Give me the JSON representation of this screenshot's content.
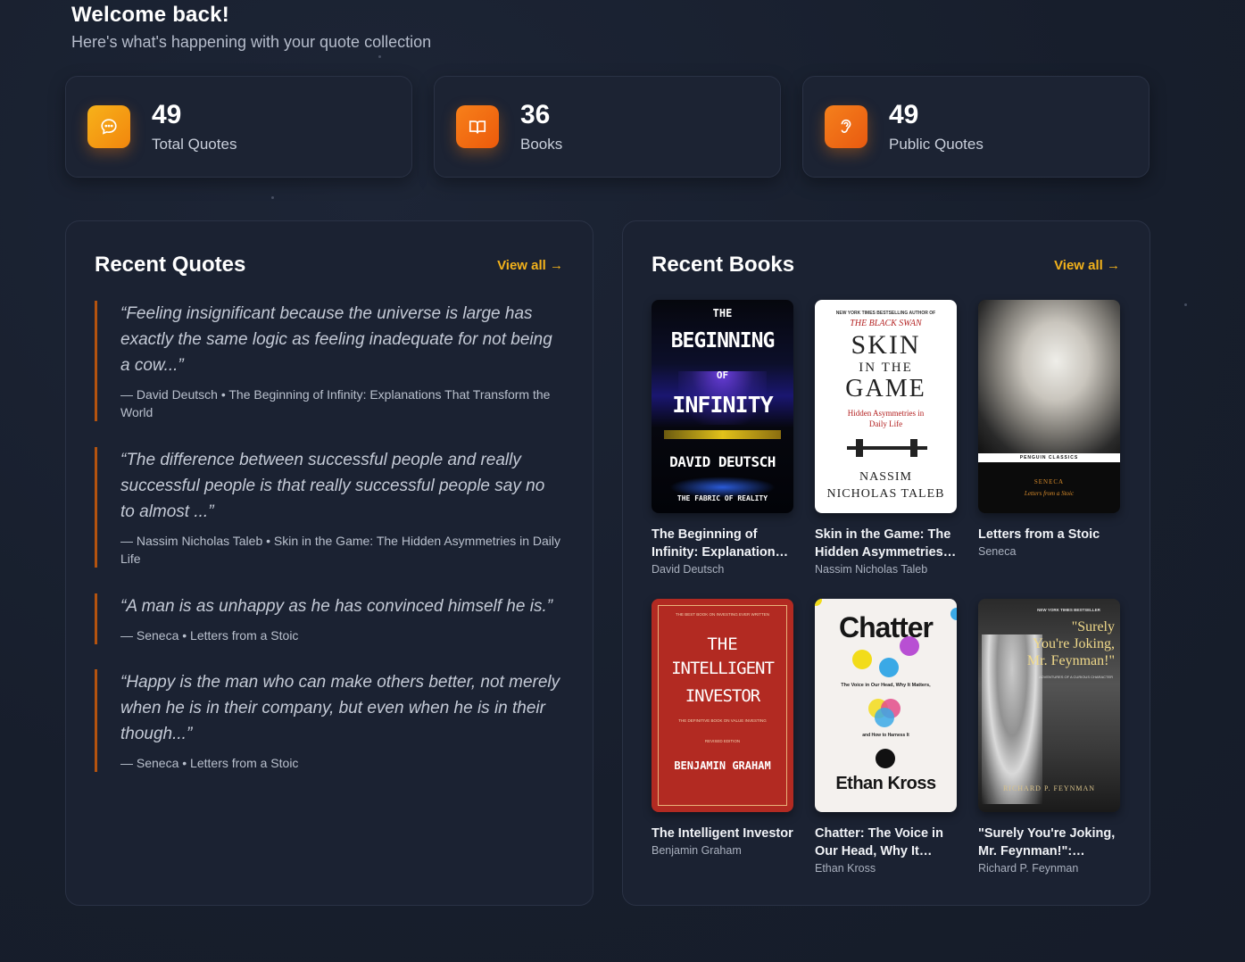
{
  "header": {
    "title": "Welcome back!",
    "subtitle": "Here's what's happening with your quote collection"
  },
  "stats": [
    {
      "value": "49",
      "label": "Total Quotes",
      "icon": "chat-bubble-icon",
      "color": "#f5a00f"
    },
    {
      "value": "36",
      "label": "Books",
      "icon": "open-book-icon",
      "color": "#f36b10"
    },
    {
      "value": "49",
      "label": "Public Quotes",
      "icon": "ear-icon",
      "color": "#f07012"
    }
  ],
  "recent_quotes": {
    "title": "Recent Quotes",
    "view_all": "View all →",
    "items": [
      {
        "text": "“Feeling insignificant because the universe is large has exactly the same logic as feeling inadequate for not being a cow...”",
        "meta": "— David Deutsch • The Beginning of Infinity: Explanations That Transform the World"
      },
      {
        "text": "“The difference between successful people and really successful people is that really successful people say no to almost ...”",
        "meta": "— Nassim Nicholas Taleb • Skin in the Game: The Hidden Asymmetries in Daily Life"
      },
      {
        "text": "“A man is as unhappy as he has convinced himself he is.”",
        "meta": "— Seneca • Letters from a Stoic"
      },
      {
        "text": "“Happy is the man who can make others better, not merely when he is in their company, but even when he is in their though...”",
        "meta": "— Seneca • Letters from a Stoic"
      }
    ]
  },
  "recent_books": {
    "title": "Recent Books",
    "view_all": "View all →",
    "items": [
      {
        "title": "The Beginning of Infinity: Explanations That Transform the World",
        "author": "David Deutsch",
        "cover": {
          "top": "THE",
          "l1": "BEGINNING",
          "of": "OF",
          "l2": "INFINITY",
          "auth": "DAVID DEUTSCH",
          "sub": "THE FABRIC OF REALITY"
        }
      },
      {
        "title": "Skin in the Game: The Hidden Asymmetries in Daily Life",
        "author": "Nassim Nicholas Taleb",
        "cover": {
          "top": "NEW YORK TIMES BESTSELLING AUTHOR OF",
          "series": "THE BLACK SWAN",
          "l1": "SKIN",
          "l2": "IN THE",
          "l3": "GAME",
          "sub": "Hidden Asymmetries in Daily Life",
          "a1": "NASSIM",
          "a2": "NICHOLAS TALEB"
        }
      },
      {
        "title": "Letters from a Stoic",
        "author": "Seneca",
        "cover": {
          "publisher": "PENGUIN CLASSICS",
          "a": "SENECA",
          "t": "Letters from a Stoic"
        }
      },
      {
        "title": "The Intelligent Investor",
        "author": "Benjamin Graham",
        "cover": {
          "top": "THE BEST BOOK ON INVESTING EVER WRITTEN",
          "l1": "THE",
          "l2": "INTELLIGENT",
          "l3": "INVESTOR",
          "sub": "THE DEFINITIVE BOOK ON VALUE INVESTING",
          "ed": "REVISED EDITION",
          "auth": "BENJAMIN GRAHAM"
        }
      },
      {
        "title": "Chatter: The Voice in Our Head, Why It Matters, and How to Harness It",
        "author": "Ethan Kross",
        "cover": {
          "l1": "Chatter",
          "sub": "The Voice in Our Head, Why It Matters,",
          "sub2": "and How to Harness It",
          "auth": "Ethan Kross"
        }
      },
      {
        "title": "\"Surely You're Joking, Mr. Feynman!\": Adventures of a Curious Character",
        "author": "Richard P. Feynman",
        "cover": {
          "top": "NEW YORK TIMES BESTSELLER",
          "l1": "\"Surely",
          "l2": "You're Joking,",
          "l3": "Mr. Feynman!\"",
          "sub": "ADVENTURES OF A CURIOUS CHARACTER",
          "auth": "RICHARD P. FEYNMAN"
        }
      }
    ]
  }
}
